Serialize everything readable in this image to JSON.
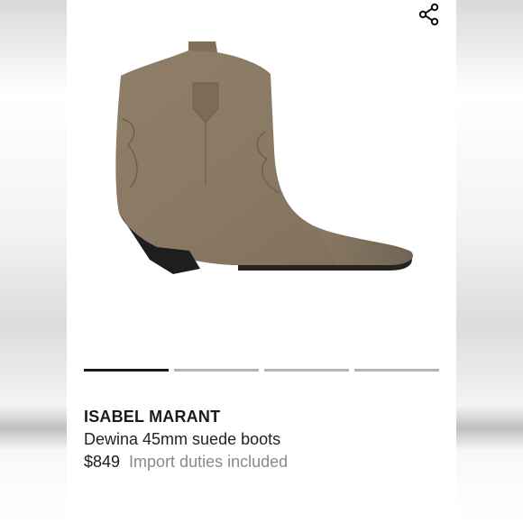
{
  "product": {
    "brand": "ISABEL MARANT",
    "name": "Dewina 45mm suede boots",
    "price": "$849",
    "duties_note": "Import duties included"
  },
  "carousel": {
    "total_images": 4,
    "active_index": 0
  },
  "icons": {
    "share": "share-icon"
  },
  "colors": {
    "suede": "#8c7b66",
    "heel": "#1e1e1e",
    "active_indicator": "#1a1a1a",
    "inactive_indicator": "#b5b5b5",
    "muted_text": "#8a8a8a"
  }
}
